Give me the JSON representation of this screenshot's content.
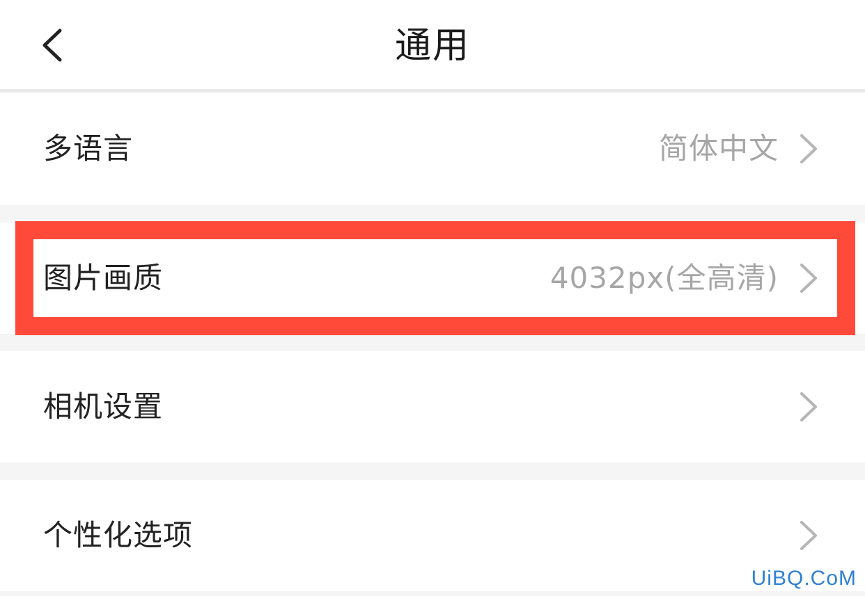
{
  "header": {
    "title": "通用",
    "back_icon": "chevron-left-icon"
  },
  "settings": {
    "items": [
      {
        "label": "多语言",
        "value": "简体中文",
        "chevron_icon": "chevron-right-icon"
      },
      {
        "label": "图片画质",
        "value": "4032px(全高清)",
        "chevron_icon": "chevron-right-icon",
        "highlighted": true
      },
      {
        "label": "相机设置",
        "value": "",
        "chevron_icon": "chevron-right-icon"
      },
      {
        "label": "个性化选项",
        "value": "",
        "chevron_icon": "chevron-right-icon"
      }
    ]
  },
  "colors": {
    "highlight": "#ff4a3a",
    "value_text": "#a6a6a6",
    "background": "#f5f5f5",
    "watermark": "#2f7fd6"
  },
  "watermark": {
    "text": "UiBQ.CoM"
  }
}
